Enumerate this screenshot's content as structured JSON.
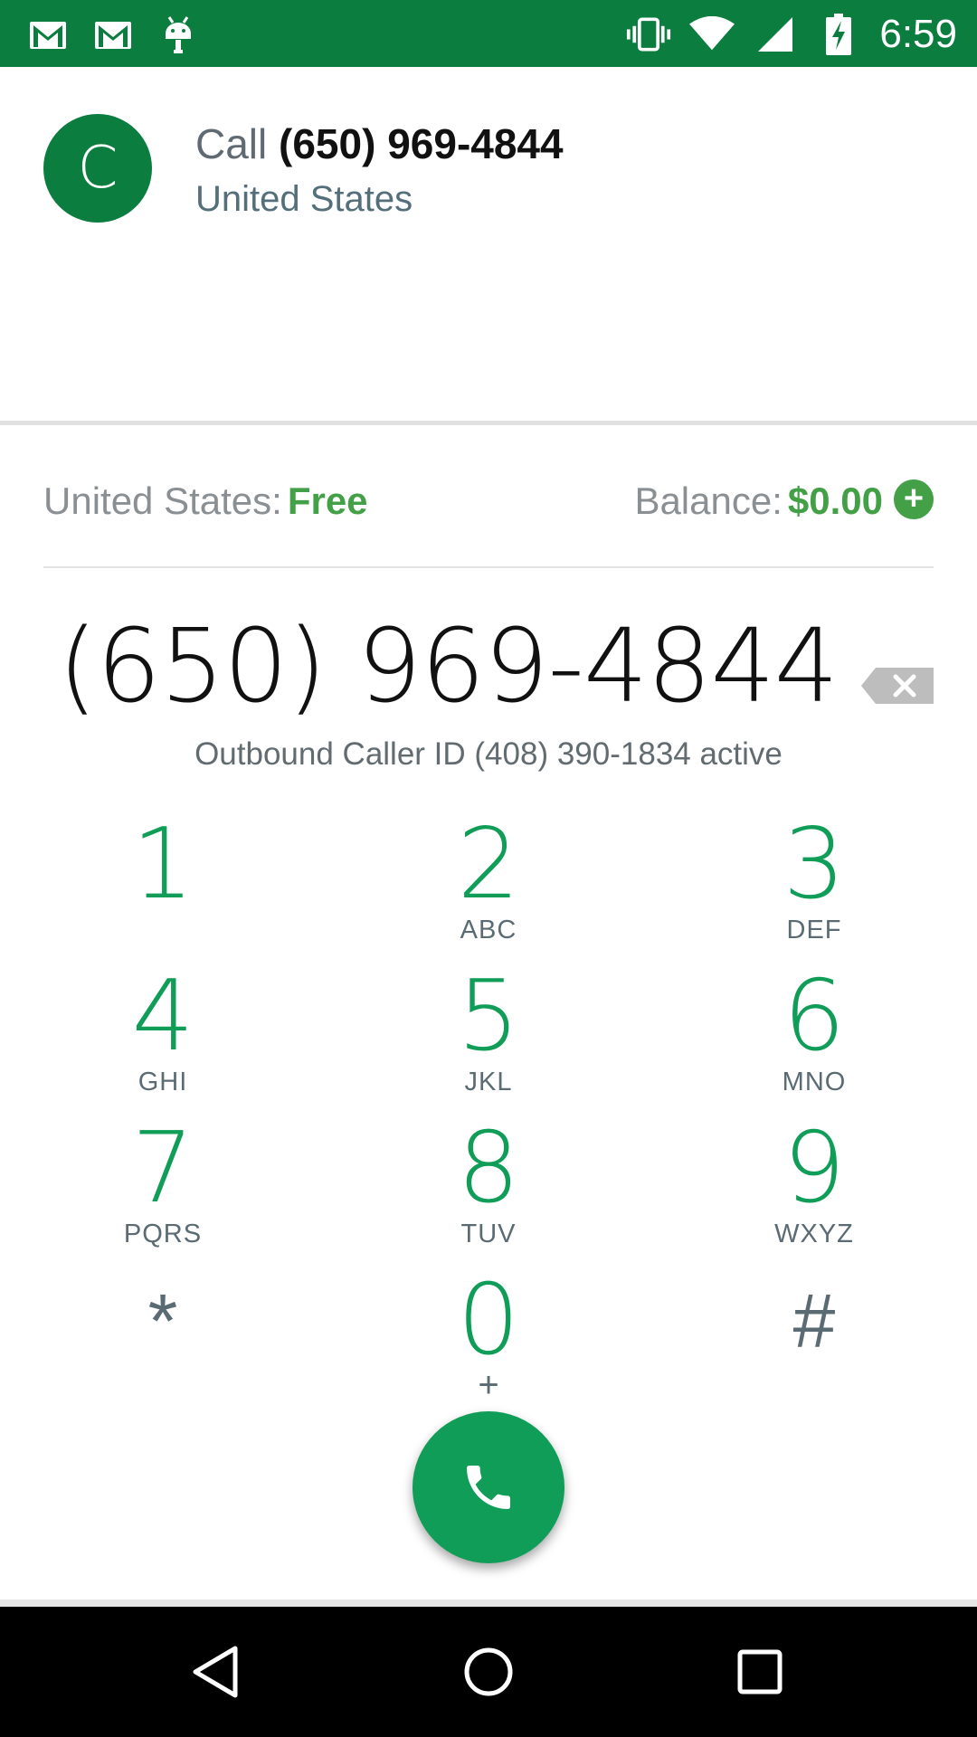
{
  "status_bar": {
    "time": "6:59",
    "icons_left": [
      "gmail-icon",
      "gmail-icon",
      "android-debug-icon"
    ],
    "icons_right": [
      "vibrate-icon",
      "wifi-icon",
      "cell-signal-icon",
      "battery-charging-icon"
    ]
  },
  "contact": {
    "avatar_letter": "C",
    "call_prefix": "Call",
    "call_number": "(650) 969-4844",
    "country": "United States"
  },
  "rates": {
    "country_label": "United States:",
    "country_rate": "Free",
    "balance_label": "Balance:",
    "balance_value": "$0.00",
    "add_label": "+"
  },
  "dialer": {
    "dialed_number": "(650) 969-4844",
    "caller_id_text": "Outbound Caller ID (408) 390-1834 active"
  },
  "keypad": {
    "keys": [
      {
        "digit": "1",
        "letters": ""
      },
      {
        "digit": "2",
        "letters": "ABC"
      },
      {
        "digit": "3",
        "letters": "DEF"
      },
      {
        "digit": "4",
        "letters": "GHI"
      },
      {
        "digit": "5",
        "letters": "JKL"
      },
      {
        "digit": "6",
        "letters": "MNO"
      },
      {
        "digit": "7",
        "letters": "PQRS"
      },
      {
        "digit": "8",
        "letters": "TUV"
      },
      {
        "digit": "9",
        "letters": "WXYZ"
      },
      {
        "digit": "*",
        "letters": ""
      },
      {
        "digit": "0",
        "letters": "+"
      },
      {
        "digit": "#",
        "letters": ""
      }
    ]
  },
  "colors": {
    "status_bar": "#0b7d3f",
    "accent_green": "#0f9d58",
    "rate_green": "#43a047",
    "navbar": "#000000"
  },
  "navigation": {
    "buttons": [
      "back-icon",
      "home-icon",
      "recents-icon"
    ]
  }
}
